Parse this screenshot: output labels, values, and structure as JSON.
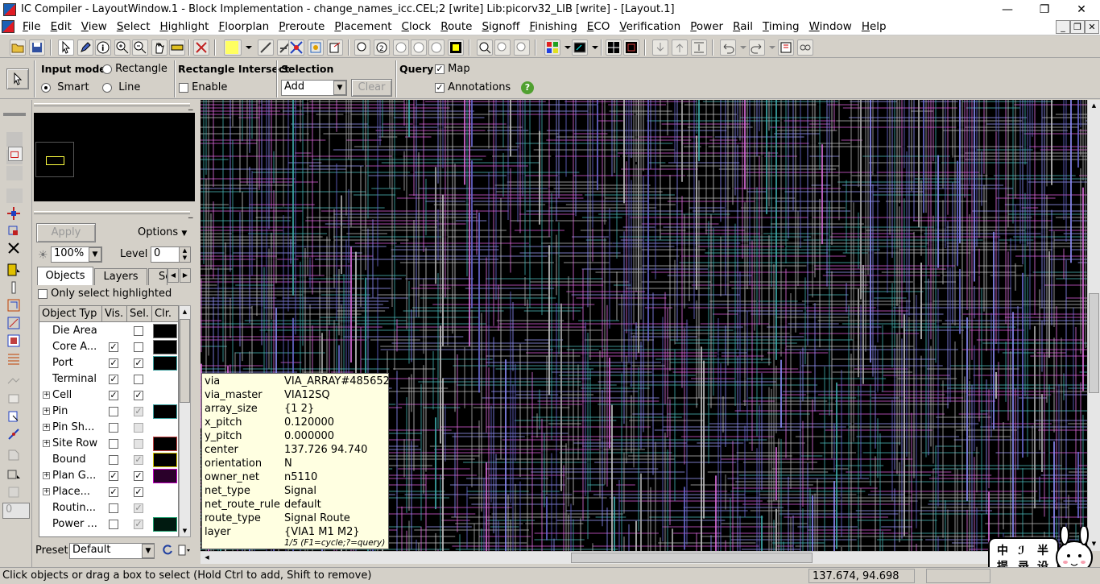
{
  "window": {
    "title": "IC Compiler - LayoutWindow.1 - Block Implementation - change_names_icc.CEL;2 [write]    Lib:picorv32_LIB [write] - [Layout.1]",
    "min": "—",
    "max": "❐",
    "close": "✕"
  },
  "menu": [
    "File",
    "Edit",
    "View",
    "Select",
    "Highlight",
    "Floorplan",
    "Preroute",
    "Placement",
    "Clock",
    "Route",
    "Signoff",
    "Finishing",
    "ECO",
    "Verification",
    "Power",
    "Rail",
    "Timing",
    "Window",
    "Help"
  ],
  "mdi_controls": [
    "_",
    "❐",
    "✕"
  ],
  "modebar": {
    "input_mode_label": "Input mode",
    "rectangle": "Rectangle",
    "smart": "Smart",
    "line": "Line",
    "rect_intersect_label": "Rectangle Intersect",
    "enable": "Enable",
    "selection_label": "Selection",
    "selection_value": "Add",
    "clear": "Clear",
    "query_label": "Query",
    "map": "Map",
    "annotations": "Annotations"
  },
  "panel": {
    "apply": "Apply",
    "options": "Options",
    "zoom": "100%",
    "level_label": "Level",
    "level_value": "0",
    "tabs": [
      "Objects",
      "Layers",
      "Se"
    ],
    "only_select_highlighted": "Only select highlighted",
    "columns": [
      "Object Typ",
      "Vis.",
      "Sel.",
      "Clr."
    ],
    "rows": [
      {
        "name": "Die Area",
        "expand": false,
        "vis": null,
        "sel": false,
        "sel_dis": false,
        "clr": "#000000",
        "clr_border": "#777777"
      },
      {
        "name": "Core A...",
        "expand": false,
        "vis": true,
        "sel": false,
        "sel_dis": false,
        "clr": "#000000",
        "clr_border": "#777777"
      },
      {
        "name": "Port",
        "expand": false,
        "vis": true,
        "sel": true,
        "sel_dis": false,
        "clr": "#000000",
        "clr_border": "#3fa0a0"
      },
      {
        "name": "Terminal",
        "expand": false,
        "vis": true,
        "sel": false,
        "sel_dis": false,
        "clr": null
      },
      {
        "name": "Cell",
        "expand": true,
        "vis": true,
        "sel": true,
        "sel_dis": false,
        "clr": null
      },
      {
        "name": "Pin",
        "expand": true,
        "vis": false,
        "sel": true,
        "sel_dis": true,
        "clr": "#000000",
        "clr_border": "#3fa0a0"
      },
      {
        "name": "Pin Sh...",
        "expand": true,
        "vis": false,
        "sel": false,
        "sel_dis": true,
        "clr": null
      },
      {
        "name": "Site Row",
        "expand": true,
        "vis": false,
        "sel": false,
        "sel_dis": true,
        "clr": "#000000",
        "clr_border": "#c04040"
      },
      {
        "name": "Bound",
        "expand": false,
        "vis": false,
        "sel": true,
        "sel_dis": true,
        "clr": "#000000",
        "clr_border": "#d0c000"
      },
      {
        "name": "Plan G...",
        "expand": true,
        "vis": true,
        "sel": true,
        "sel_dis": false,
        "clr": "#2a002a",
        "clr_border": "#c000c0"
      },
      {
        "name": "Place...",
        "expand": true,
        "vis": true,
        "sel": true,
        "sel_dis": false,
        "clr": null
      },
      {
        "name": "Routin...",
        "expand": false,
        "vis": false,
        "sel": true,
        "sel_dis": true,
        "clr": null
      },
      {
        "name": "Power ...",
        "expand": false,
        "vis": false,
        "sel": true,
        "sel_dis": true,
        "clr": "#001a10",
        "clr_border": "#20a070"
      }
    ],
    "preset_label": "Preset",
    "preset_value": "Default"
  },
  "tooltip": {
    "rows": [
      {
        "k": "via",
        "v": "VIA_ARRAY#485652"
      },
      {
        "k": "via_master",
        "v": "VIA12SQ"
      },
      {
        "k": "array_size",
        "v": "{1  2}"
      },
      {
        "k": "x_pitch",
        "v": "0.120000"
      },
      {
        "k": "y_pitch",
        "v": "0.000000"
      },
      {
        "k": "center",
        "v": "137.726  94.740"
      },
      {
        "k": "orientation",
        "v": "N"
      },
      {
        "k": "owner_net",
        "v": "n5110"
      },
      {
        "k": "net_type",
        "v": "Signal"
      },
      {
        "k": "net_route_rule",
        "v": "default"
      },
      {
        "k": "route_type",
        "v": "Signal  Route"
      },
      {
        "k": "layer",
        "v": "{VIA1  M1  M2}"
      }
    ],
    "footer": "1/5 (F1=cycle;?=query)"
  },
  "status": {
    "message": "Click objects or drag a box to select (Hold Ctrl to add, Shift to remove)",
    "coords": "137.674, 94.698"
  },
  "watermark_text": "中 半 提 录 设",
  "colors": {
    "canvas_bg": "#000000",
    "metal_v": [
      "#6b6bd6",
      "#c8c8c8",
      "#e070e0",
      "#40b0b0",
      "#9090ff",
      "#b0b0b0"
    ],
    "metal_h": [
      "#c0c0c0",
      "#e060e0",
      "#50c0c0",
      "#a0a0ff"
    ],
    "tooltip_bg": "#ffffe1"
  }
}
